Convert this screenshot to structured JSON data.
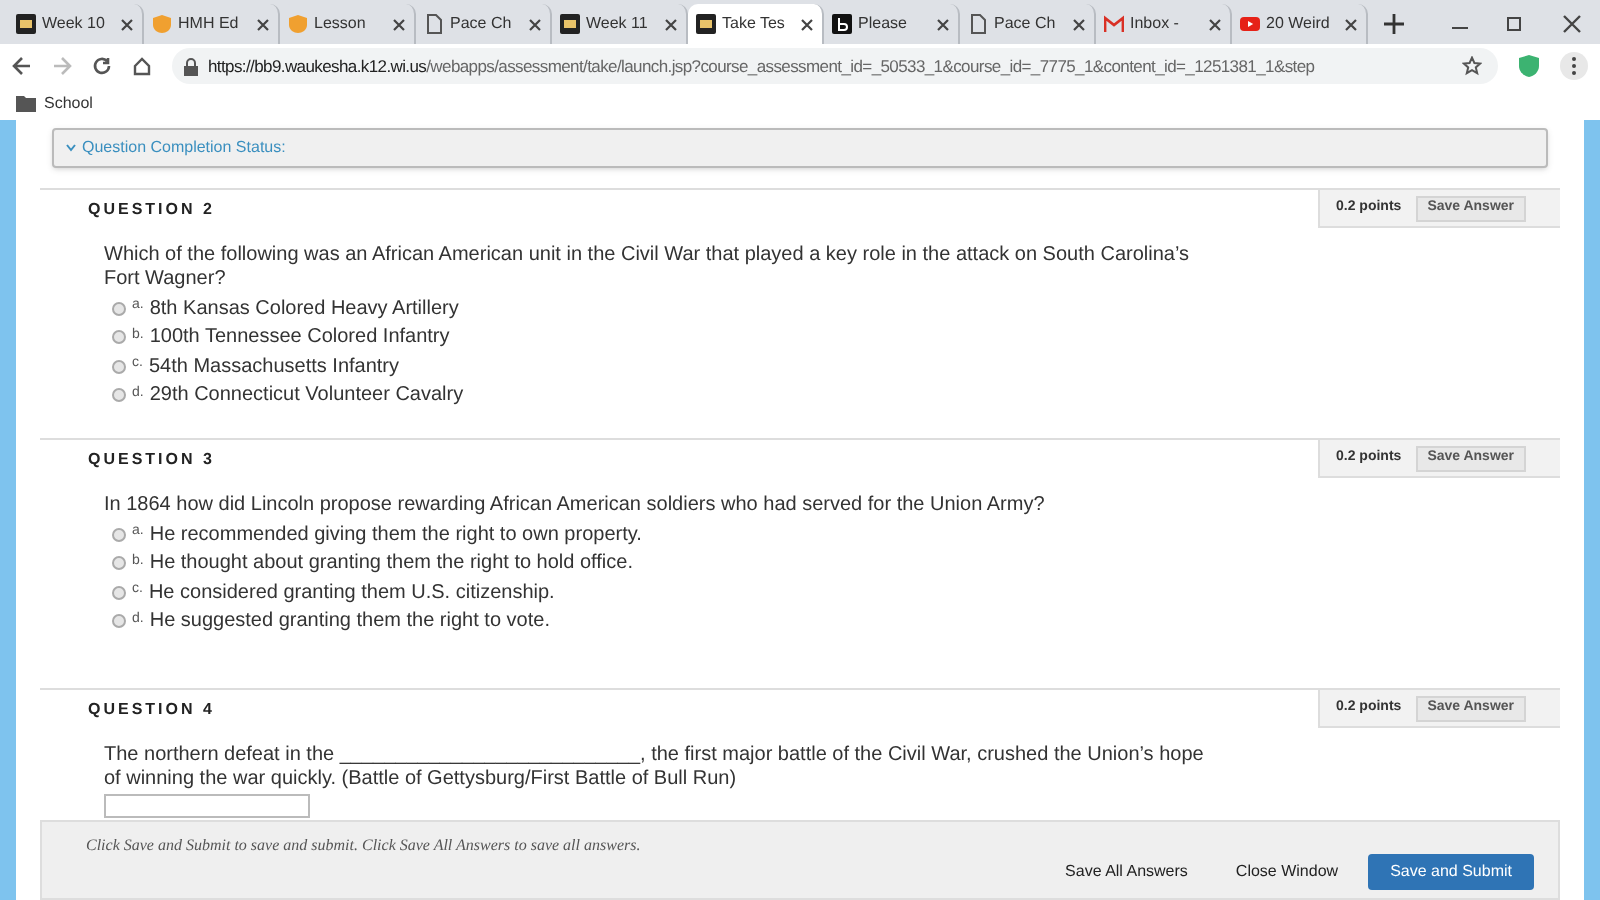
{
  "browser": {
    "tabs": [
      {
        "title": "Week 10",
        "kind": "bb",
        "selected": false
      },
      {
        "title": "HMH Ed",
        "kind": "shield",
        "selected": false
      },
      {
        "title": "Lesson",
        "kind": "shield",
        "selected": false
      },
      {
        "title": "Pace Ch",
        "kind": "doc",
        "selected": false
      },
      {
        "title": "Week 11",
        "kind": "bb",
        "selected": false
      },
      {
        "title": "Take Tes",
        "kind": "bb",
        "selected": true
      },
      {
        "title": "Please",
        "kind": "b",
        "selected": false
      },
      {
        "title": "Pace Ch",
        "kind": "doc",
        "selected": false
      },
      {
        "title": "Inbox -",
        "kind": "mail",
        "selected": false
      },
      {
        "title": "20 Weird",
        "kind": "video",
        "selected": false
      }
    ],
    "address_host": "https://bb9.waukesha.k12.wi.us",
    "address_path": "/webapps/assessment/take/launch.jsp?course_assessment_id=_50533_1&course_id=_7775_1&content_id=_1251381_1&step",
    "bookmarks": [
      "School"
    ]
  },
  "completion_status": "Question Completion Status:",
  "questions": [
    {
      "kind": "choice",
      "number": "QUESTION 2",
      "points": "0.2 points",
      "save": "Save Answer",
      "text": "Which of the following was an African American unit in the Civil War that played a key role in the attack on South Carolina’s Fort Wagner?",
      "options": [
        {
          "letter": "a.",
          "text": "8th Kansas Colored Heavy Artillery",
          "selected": false
        },
        {
          "letter": "b.",
          "text": "100th Tennessee Colored Infantry",
          "selected": false
        },
        {
          "letter": "c.",
          "text": "54th Massachusetts Infantry",
          "selected": false
        },
        {
          "letter": "d.",
          "text": "29th Connecticut Volunteer Cavalry",
          "selected": false
        }
      ]
    },
    {
      "kind": "choice",
      "number": "QUESTION 3",
      "points": "0.2 points",
      "save": "Save Answer",
      "text": "In 1864 how did Lincoln propose rewarding African American soldiers who had served for the Union Army?",
      "options": [
        {
          "letter": "a.",
          "text": "He recommended giving them the right to own property.",
          "selected": false
        },
        {
          "letter": "b.",
          "text": "He thought about granting them the right to hold office.",
          "selected": false
        },
        {
          "letter": "c.",
          "text": "He considered granting them U.S. citizenship.",
          "selected": false
        },
        {
          "letter": "d.",
          "text": "He suggested granting them the right to vote.",
          "selected": false
        }
      ]
    },
    {
      "kind": "fill",
      "number": "QUESTION 4",
      "points": "0.2 points",
      "save": "Save Answer",
      "text": "The northern defeat in the ___________________________, the first major battle of the Civil War, crushed the Union’s hope of winning the war quickly. (Battle of Gettysburg/First Battle of Bull Run)"
    }
  ],
  "footer": {
    "hint": "Click Save and Submit to save and submit. Click Save All Answers to save all answers.",
    "buttons": [
      {
        "label": "Save All Answers",
        "kind": "plain"
      },
      {
        "label": "Close Window",
        "kind": "plain"
      },
      {
        "label": "Save and Submit",
        "kind": "primary"
      }
    ]
  }
}
